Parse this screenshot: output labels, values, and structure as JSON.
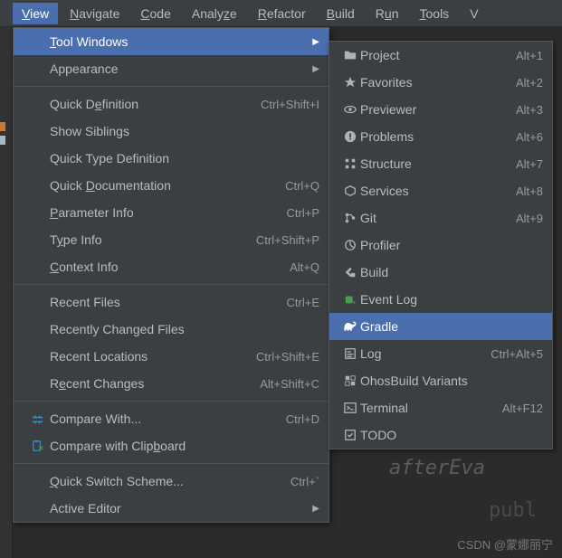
{
  "menubar": {
    "items": [
      {
        "pre": "",
        "u": "V",
        "post": "iew",
        "active": true
      },
      {
        "pre": "",
        "u": "N",
        "post": "avigate"
      },
      {
        "pre": "",
        "u": "C",
        "post": "ode"
      },
      {
        "pre": "Analy",
        "u": "z",
        "post": "e"
      },
      {
        "pre": "",
        "u": "R",
        "post": "efactor"
      },
      {
        "pre": "",
        "u": "B",
        "post": "uild"
      },
      {
        "pre": "R",
        "u": "u",
        "post": "n"
      },
      {
        "pre": "",
        "u": "T",
        "post": "ools"
      },
      {
        "pre": "V",
        "u": "",
        "post": ""
      }
    ]
  },
  "viewMenu": [
    {
      "type": "item",
      "label_pre": "",
      "label_u": "T",
      "label_post": "ool Windows",
      "shortcut": "",
      "arrow": true,
      "hover": true,
      "icon": ""
    },
    {
      "type": "item",
      "label_pre": "Appearance",
      "label_u": "",
      "label_post": "",
      "shortcut": "",
      "arrow": true,
      "icon": ""
    },
    {
      "type": "sep"
    },
    {
      "type": "item",
      "label_pre": "Quick D",
      "label_u": "e",
      "label_post": "finition",
      "shortcut": "Ctrl+Shift+I",
      "icon": ""
    },
    {
      "type": "item",
      "label_pre": "Show Siblings",
      "label_u": "",
      "label_post": "",
      "shortcut": "",
      "icon": ""
    },
    {
      "type": "item",
      "label_pre": "Quick Type Definition",
      "label_u": "",
      "label_post": "",
      "shortcut": "",
      "icon": ""
    },
    {
      "type": "item",
      "label_pre": "Quick ",
      "label_u": "D",
      "label_post": "ocumentation",
      "shortcut": "Ctrl+Q",
      "icon": ""
    },
    {
      "type": "item",
      "label_pre": "",
      "label_u": "P",
      "label_post": "arameter Info",
      "shortcut": "Ctrl+P",
      "icon": ""
    },
    {
      "type": "item",
      "label_pre": "T",
      "label_u": "y",
      "label_post": "pe Info",
      "shortcut": "Ctrl+Shift+P",
      "icon": ""
    },
    {
      "type": "item",
      "label_pre": "",
      "label_u": "C",
      "label_post": "ontext Info",
      "shortcut": "Alt+Q",
      "icon": ""
    },
    {
      "type": "sep"
    },
    {
      "type": "item",
      "label_pre": "Recent Files",
      "label_u": "",
      "label_post": "",
      "shortcut": "Ctrl+E",
      "icon": ""
    },
    {
      "type": "item",
      "label_pre": "Recently Changed Files",
      "label_u": "",
      "label_post": "",
      "shortcut": "",
      "icon": ""
    },
    {
      "type": "item",
      "label_pre": "Recent Locations",
      "label_u": "",
      "label_post": "",
      "shortcut": "Ctrl+Shift+E",
      "icon": ""
    },
    {
      "type": "item",
      "label_pre": "R",
      "label_u": "e",
      "label_post": "cent Changes",
      "shortcut": "Alt+Shift+C",
      "icon": ""
    },
    {
      "type": "sep"
    },
    {
      "type": "item",
      "label_pre": "Compare With...",
      "label_u": "",
      "label_post": "",
      "shortcut": "Ctrl+D",
      "icon": "compare"
    },
    {
      "type": "item",
      "label_pre": "Compare with Clip",
      "label_u": "b",
      "label_post": "oard",
      "shortcut": "",
      "icon": "clip"
    },
    {
      "type": "sep"
    },
    {
      "type": "item",
      "label_pre": "",
      "label_u": "Q",
      "label_post": "uick Switch Scheme...",
      "shortcut": "Ctrl+`",
      "icon": ""
    },
    {
      "type": "item",
      "label_pre": "Active Editor",
      "label_u": "",
      "label_post": "",
      "shortcut": "",
      "arrow": true,
      "icon": ""
    }
  ],
  "toolMenu": [
    {
      "label": "Project",
      "shortcut": "Alt+1",
      "icon": "folder"
    },
    {
      "label": "Favorites",
      "shortcut": "Alt+2",
      "icon": "star"
    },
    {
      "label": "Previewer",
      "shortcut": "Alt+3",
      "icon": "eye"
    },
    {
      "label": "Problems",
      "shortcut": "Alt+6",
      "icon": "warn"
    },
    {
      "label": "Structure",
      "shortcut": "Alt+7",
      "icon": "struct"
    },
    {
      "label": "Services",
      "shortcut": "Alt+8",
      "icon": "services"
    },
    {
      "label": "Git",
      "shortcut": "Alt+9",
      "icon": "git"
    },
    {
      "label": "Profiler",
      "shortcut": "",
      "icon": "profiler"
    },
    {
      "label": "Build",
      "shortcut": "",
      "icon": "build"
    },
    {
      "label": "Event Log",
      "shortcut": "",
      "icon": "event",
      "green": true
    },
    {
      "label": "Gradle",
      "shortcut": "",
      "icon": "gradle",
      "hover": true
    },
    {
      "label": "Log",
      "shortcut": "Ctrl+Alt+5",
      "icon": "log"
    },
    {
      "label": "OhosBuild Variants",
      "shortcut": "",
      "icon": "variants"
    },
    {
      "label": "Terminal",
      "shortcut": "Alt+F12",
      "icon": "terminal"
    },
    {
      "label": "TODO",
      "shortcut": "",
      "icon": "todo"
    }
  ],
  "codeBg": {
    "line1": "afterEva",
    "line2": "publ"
  },
  "watermark": "CSDN @蒙娜丽宁"
}
